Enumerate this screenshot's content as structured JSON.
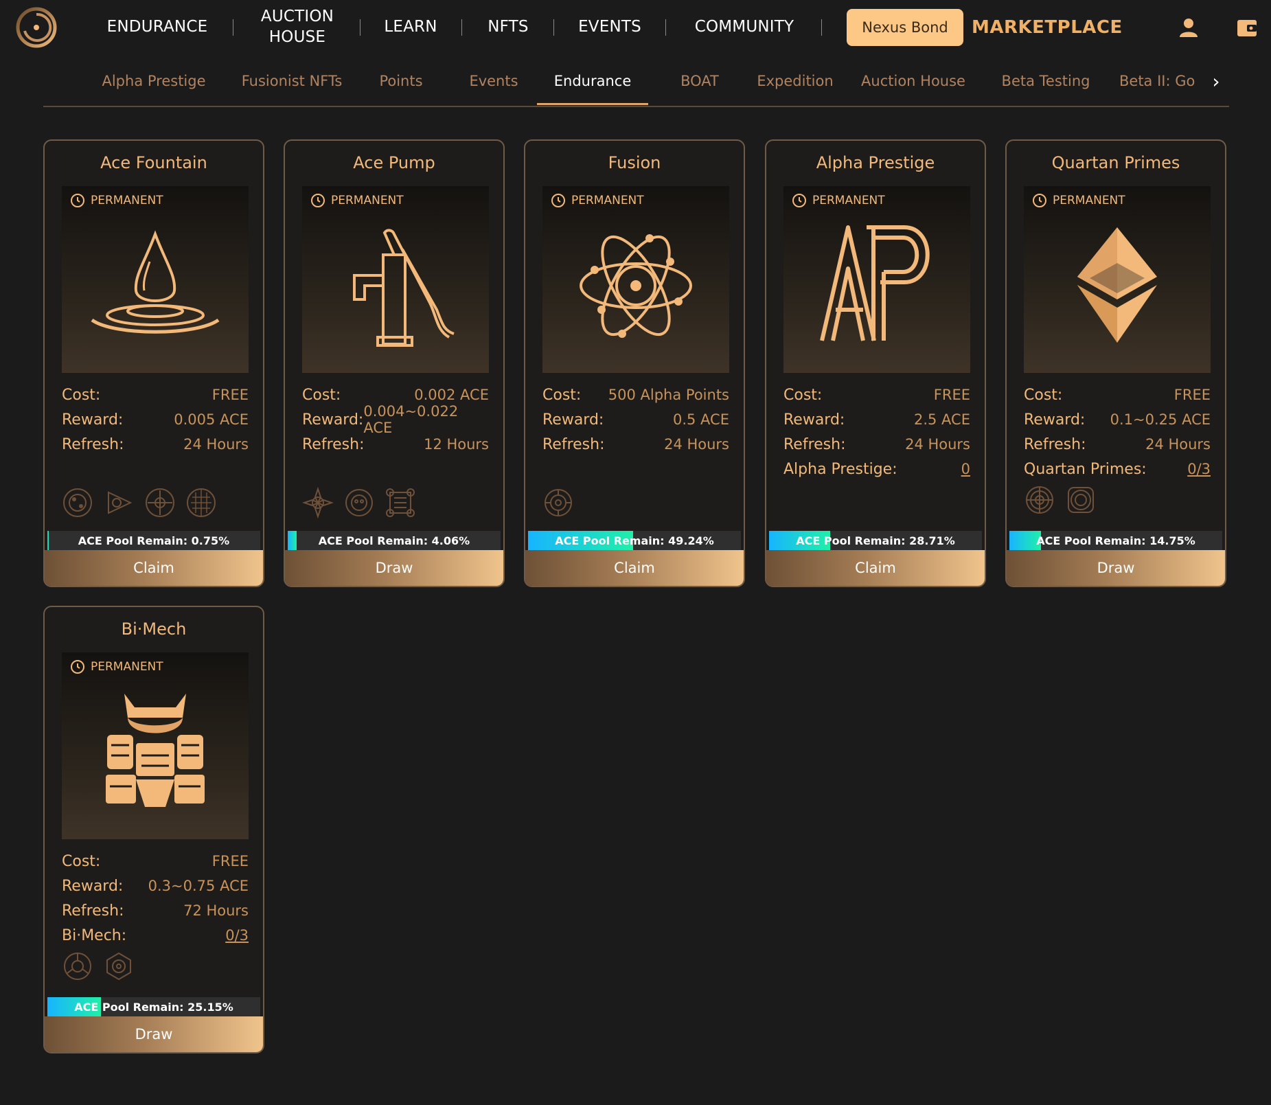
{
  "nav": {
    "items": [
      "ENDURANCE",
      "AUCTION\nHOUSE",
      "LEARN",
      "NFTS",
      "EVENTS",
      "COMMUNITY"
    ],
    "nexus_bond": "Nexus Bond",
    "marketplace": "MARKETPLACE",
    "icons": [
      "logo-icon",
      "user-icon",
      "wallet-icon"
    ]
  },
  "tabs": {
    "items": [
      "Alpha Prestige",
      "Fusionist NFTs",
      "Points",
      "Events",
      "Endurance",
      "BOAT",
      "Expedition",
      "Auction House",
      "Beta Testing",
      "Beta II: Go"
    ],
    "active": "Endurance"
  },
  "colors": {
    "accent": "#f2b97a",
    "background": "#1b1b1b",
    "nexus_bg": "#fdc785",
    "pool_fill_start": "#18b4ff",
    "pool_fill_end": "#1ff0a8"
  },
  "cards": [
    {
      "title": "Ace Fountain",
      "badge": "PERMANENT",
      "icon": "water-drop-icon",
      "rows": [
        {
          "label": "Cost:",
          "value": "FREE"
        },
        {
          "label": "Reward:",
          "value": "0.005 ACE"
        },
        {
          "label": "Refresh:",
          "value": "24 Hours"
        }
      ],
      "pool_text": "ACE Pool Remain: 0.75%",
      "pool_percent": 0.75,
      "action": "Claim"
    },
    {
      "title": "Ace Pump",
      "badge": "PERMANENT",
      "icon": "water-pump-icon",
      "rows": [
        {
          "label": "Cost:",
          "value": "0.002 ACE"
        },
        {
          "label": "Reward:",
          "value": "0.004~0.022 ACE"
        },
        {
          "label": "Refresh:",
          "value": "12 Hours"
        }
      ],
      "pool_text": "ACE Pool Remain: 4.06%",
      "pool_percent": 4.06,
      "action": "Draw"
    },
    {
      "title": "Fusion",
      "badge": "PERMANENT",
      "icon": "atom-icon",
      "rows": [
        {
          "label": "Cost:",
          "value": "500 Alpha Points"
        },
        {
          "label": "Reward:",
          "value": "0.5 ACE"
        },
        {
          "label": "Refresh:",
          "value": "24 Hours"
        }
      ],
      "pool_text": "ACE Pool Remain: 49.24%",
      "pool_percent": 49.24,
      "action": "Claim"
    },
    {
      "title": "Alpha Prestige",
      "badge": "PERMANENT",
      "icon": "ap-logo-icon",
      "rows": [
        {
          "label": "Cost:",
          "value": "FREE"
        },
        {
          "label": "Reward:",
          "value": "2.5 ACE"
        },
        {
          "label": "Refresh:",
          "value": "24 Hours"
        },
        {
          "label": "Alpha Prestige:",
          "value": "0",
          "link": true
        }
      ],
      "pool_text": "ACE Pool Remain: 28.71%",
      "pool_percent": 28.71,
      "action": "Claim"
    },
    {
      "title": "Quartan Primes",
      "badge": "PERMANENT",
      "icon": "diamond-icon",
      "rows": [
        {
          "label": "Cost:",
          "value": "FREE"
        },
        {
          "label": "Reward:",
          "value": "0.1~0.25 ACE"
        },
        {
          "label": "Refresh:",
          "value": "24 Hours"
        },
        {
          "label": "Quartan Primes:",
          "value": "0/3",
          "link": true
        }
      ],
      "pool_text": "ACE Pool Remain: 14.75%",
      "pool_percent": 14.75,
      "action": "Draw"
    },
    {
      "title": "Bi·Mech",
      "badge": "PERMANENT",
      "icon": "mech-robot-icon",
      "rows": [
        {
          "label": "Cost:",
          "value": "FREE"
        },
        {
          "label": "Reward:",
          "value": "0.3~0.75 ACE"
        },
        {
          "label": "Refresh:",
          "value": "72 Hours"
        },
        {
          "label": "Bi·Mech:",
          "value": "0/3",
          "link": true
        }
      ],
      "pool_text": "ACE Pool Remain: 25.15%",
      "pool_percent": 25.15,
      "action": "Draw"
    }
  ]
}
